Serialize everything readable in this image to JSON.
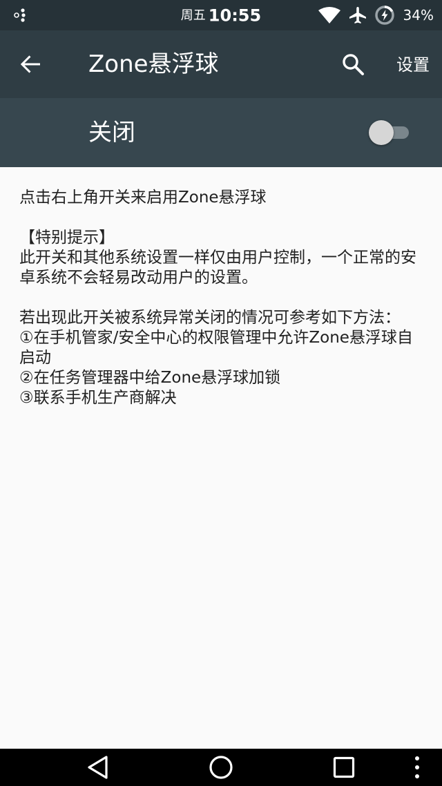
{
  "status_bar": {
    "day": "周五",
    "time": "10:55",
    "battery": "34%",
    "icons": [
      "notification-dots-icon",
      "wifi-icon",
      "airplane-mode-icon",
      "battery-charging-icon"
    ]
  },
  "app_bar": {
    "title": "Zone悬浮球",
    "back_icon": "arrow-back-icon",
    "search_icon": "search-icon",
    "settings_label": "设置"
  },
  "switch_bar": {
    "label": "关闭",
    "state": "off"
  },
  "content": {
    "intro": "点击右上角开关来启用Zone悬浮球",
    "notice_title": "【特别提示】",
    "notice_body": "此开关和其他系统设置一样仅由用户控制，一个正常的安卓系统不会轻易改动用户的设置。",
    "troubleshoot_intro": "若出现此开关被系统异常关闭的情况可参考如下方法：",
    "step1": "①在手机管家/安全中心的权限管理中允许Zone悬浮球自启动",
    "step2": "②在任务管理器中给Zone悬浮球加锁",
    "step3": "③联系手机生产商解决"
  },
  "nav_bar": {
    "icons": [
      "back-triangle-icon",
      "home-circle-icon",
      "recents-square-icon",
      "more-vert-icon"
    ]
  },
  "colors": {
    "status_bar_bg": "#263238",
    "app_bar_bg": "#2f3d44",
    "switch_bar_bg": "#37474f",
    "content_bg": "#fafafa",
    "text": "#212121"
  }
}
